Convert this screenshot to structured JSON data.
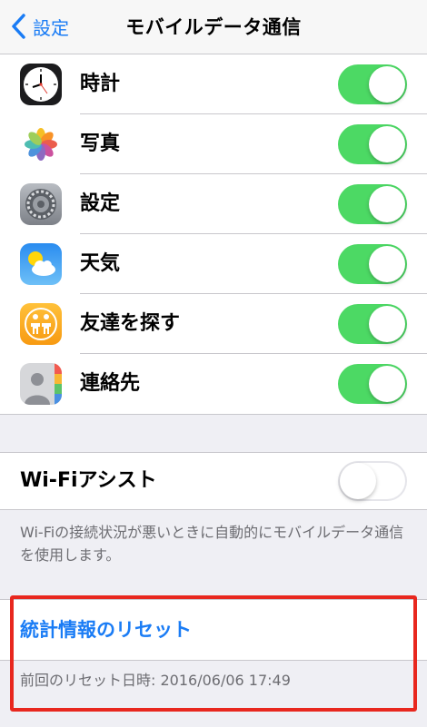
{
  "navbar": {
    "back_label": "設定",
    "title": "モバイルデータ通信"
  },
  "apps": [
    {
      "label": "時計",
      "icon": "clock-icon",
      "enabled": true
    },
    {
      "label": "写真",
      "icon": "photos-icon",
      "enabled": true
    },
    {
      "label": "設定",
      "icon": "settings-gear-icon",
      "enabled": true
    },
    {
      "label": "天気",
      "icon": "weather-icon",
      "enabled": true
    },
    {
      "label": "友達を探す",
      "icon": "find-friends-icon",
      "enabled": true
    },
    {
      "label": "連絡先",
      "icon": "contacts-icon",
      "enabled": true
    }
  ],
  "wifi_assist": {
    "label": "Wi-Fiアシスト",
    "enabled": false,
    "description": "Wi-Fiの接続状況が悪いときに自動的にモバイルデータ通信を使用します。"
  },
  "reset": {
    "link_label": "統計情報のリセット",
    "last_reset": "前回のリセット日時: 2016/06/06 17:49"
  },
  "colors": {
    "accent": "#1a7cf5",
    "toggle_on": "#4cd964",
    "highlight": "#e8271e",
    "background": "#efeff4"
  }
}
